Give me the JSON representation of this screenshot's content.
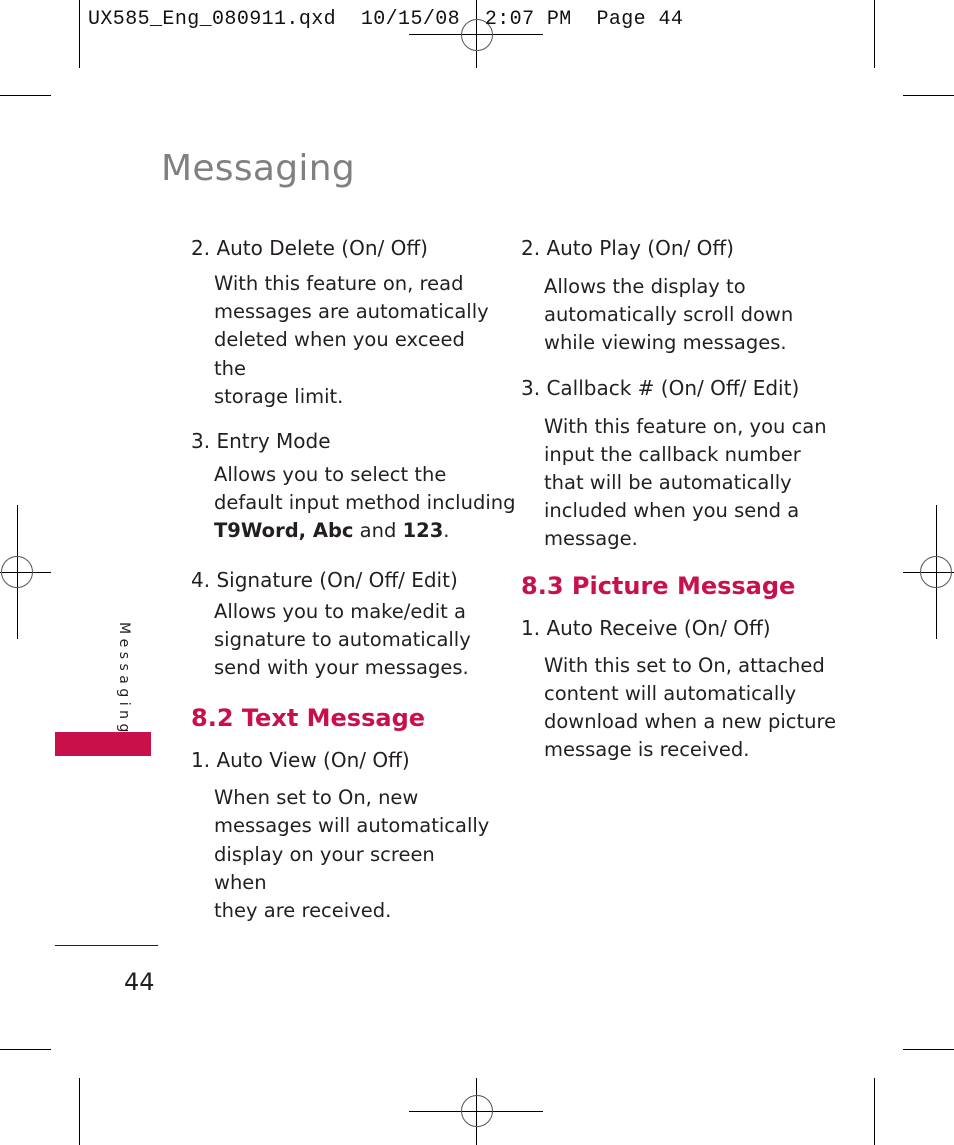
{
  "print_slug": "UX585_Eng_080911.qxd  10/15/08  2:07 PM  Page 44",
  "page_title": "Messaging",
  "side_tab": {
    "label": "Messaging",
    "color": "#c8104a"
  },
  "page_number": "44",
  "accent_color": "#c8104a",
  "left_column": {
    "items": [
      {
        "heading": "2. Auto Delete (On/ Off)",
        "body": [
          "With this feature on, read",
          "messages are automatically",
          "deleted when you exceed the",
          "storage limit."
        ]
      },
      {
        "heading": "3. Entry Mode",
        "body": [
          "Allows you to select the",
          "default input method including"
        ],
        "body_rich": {
          "bold1": "T9Word, Abc",
          "mid": " and ",
          "bold2": "123",
          "end": "."
        }
      },
      {
        "heading": "4. Signature (On/ Off/ Edit)",
        "body": [
          "Allows you to make/edit a",
          "signature to automatically",
          "send with your messages."
        ]
      }
    ],
    "section": {
      "title": "8.2 Text Message",
      "items": [
        {
          "heading": "1. Auto View (On/ Off)",
          "body": [
            "When set to On, new",
            "messages will automatically",
            "display on your screen when",
            "they are received."
          ]
        }
      ]
    }
  },
  "right_column": {
    "items": [
      {
        "heading": "2. Auto Play (On/ Off)",
        "body": [
          "Allows the display to",
          "automatically scroll down",
          "while viewing messages."
        ]
      },
      {
        "heading": "3. Callback # (On/ Off/ Edit)",
        "body": [
          "With this feature on, you can",
          "input the callback number",
          "that will be automatically",
          "included when you send a",
          "message."
        ]
      }
    ],
    "section": {
      "title": "8.3 Picture Message",
      "items": [
        {
          "heading": "1. Auto Receive (On/ Off)",
          "body": [
            "With this set to On, attached",
            "content will automatically",
            "download when a new picture",
            "message is received."
          ]
        }
      ]
    }
  }
}
